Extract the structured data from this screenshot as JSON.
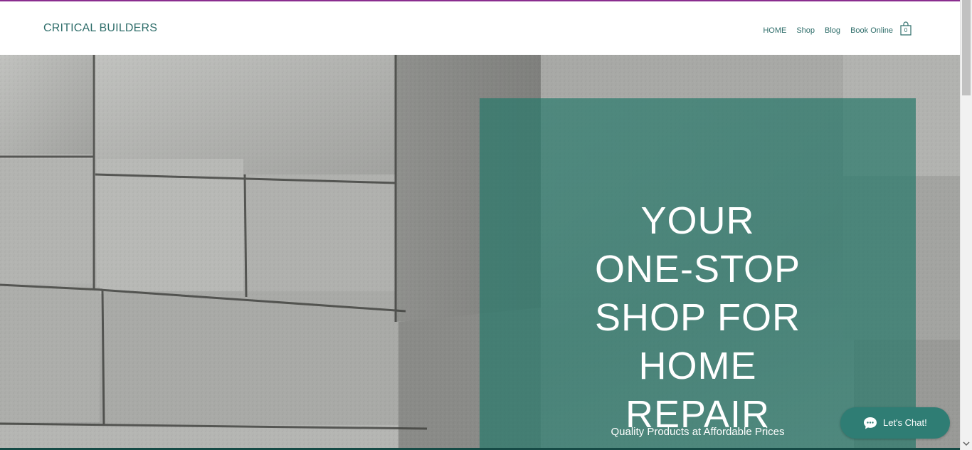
{
  "header": {
    "brand": "CRITICAL BUILDERS",
    "nav": [
      {
        "label": "HOME"
      },
      {
        "label": "Shop"
      },
      {
        "label": "Blog"
      },
      {
        "label": "Book Online"
      }
    ],
    "cart_count": "0"
  },
  "hero": {
    "title_lines": [
      "YOUR",
      "ONE-STOP",
      "SHOP FOR",
      "HOME",
      "REPAIR"
    ],
    "subtitle": "Quality Products at Affordable Prices"
  },
  "chat": {
    "label": "Let's Chat!",
    "icon": "chat-bubble-icon"
  },
  "colors": {
    "accent": "#8a2d8f",
    "brand": "#2e6d6a",
    "panel": "#2a786b",
    "chat": "#2f7d74"
  }
}
